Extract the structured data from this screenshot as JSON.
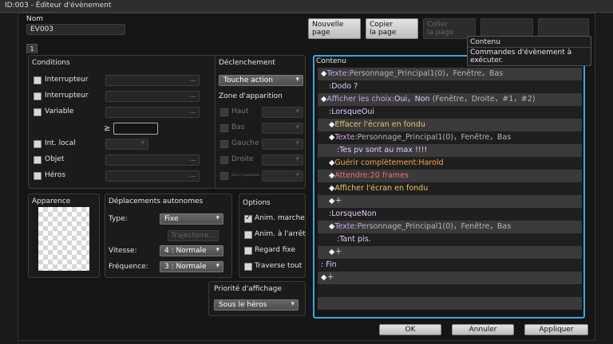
{
  "window_title": "ID:003 - Éditeur d'évènement",
  "name_label": "Nom",
  "name_value": "EV003",
  "page_tab": "1",
  "toolbar": {
    "new_page": [
      "Nouvelle",
      "page"
    ],
    "copy_page": [
      "Copier",
      "la page"
    ],
    "paste_page": [
      "Coller",
      "la page"
    ]
  },
  "tooltip": {
    "title": "Contenu",
    "text": "Commandes d'évènement à exécuter."
  },
  "conditions": {
    "title": "Conditions",
    "switch1": "Interrupteur",
    "switch2": "Interrupteur",
    "variable": "Variable",
    "gte": "≥",
    "self_switch": "Int. local",
    "item": "Objet",
    "actor": "Héros",
    "dots": "..."
  },
  "trigger": {
    "title": "Déclenchement",
    "value": "Touche action",
    "spawn_zone": "Zone d'apparition",
    "up": "Haut",
    "down": "Bas",
    "left": "Gauche",
    "right": "Droite",
    "spawn_zone_small": "Zone d'apparition"
  },
  "appearance": {
    "title": "Apparence"
  },
  "movement": {
    "title": "Déplacements autonomes",
    "type_label": "Type:",
    "type_value": "Fixe",
    "route_button": "Trajectoire...",
    "speed_label": "Vitesse:",
    "speed_value": "4 : Normale",
    "freq_label": "Fréquence:",
    "freq_value": "3 : Normale"
  },
  "options": {
    "title": "Options",
    "walk_anim": "Anim. marche",
    "step_anim": "Anim. à l'arrêt",
    "direction_fix": "Regard fixe",
    "through": "Traverse tout"
  },
  "priority": {
    "title": "Priorité d'affichage",
    "value": "Sous le héros"
  },
  "content": {
    "title": "Contenu",
    "rows": [
      {
        "indent": 0,
        "parts": [
          [
            "◆",
            ""
          ],
          [
            "Texte:",
            "txt"
          ],
          [
            "Personnage_Principal1(0)，Fenêtre，Bas",
            "muted"
          ]
        ]
      },
      {
        "indent": 1,
        "parts": [
          [
            ":Dodo ?",
            "par"
          ]
        ]
      },
      {
        "indent": 0,
        "parts": [
          [
            "◆",
            ""
          ],
          [
            "Afficher les choix:",
            "txt"
          ],
          [
            "Oui，Non ",
            "par"
          ],
          [
            "(Fenêtre，Droite，#1，#2)",
            "muted"
          ]
        ]
      },
      {
        "indent": 1,
        "parts": [
          [
            ":LorsqueOui",
            "par"
          ]
        ]
      },
      {
        "indent": 1,
        "parts": [
          [
            "◆",
            ""
          ],
          [
            "Effacer l'écran en fondu",
            "yel"
          ]
        ]
      },
      {
        "indent": 1,
        "parts": [
          [
            "◆",
            ""
          ],
          [
            "Texte:",
            "txt"
          ],
          [
            "Personnage_Principal1(0)，Fenêtre，Bas",
            "muted"
          ]
        ]
      },
      {
        "indent": 2,
        "parts": [
          [
            ":Tes pv sont au max !!!!",
            "par"
          ]
        ]
      },
      {
        "indent": 1,
        "parts": [
          [
            "◆",
            ""
          ],
          [
            "Guérir complètement:Harold",
            "orng"
          ]
        ]
      },
      {
        "indent": 1,
        "parts": [
          [
            "◆",
            ""
          ],
          [
            "Attendre:20 frames",
            "red"
          ]
        ]
      },
      {
        "indent": 1,
        "parts": [
          [
            "◆",
            ""
          ],
          [
            "Afficher l'écran en fondu",
            "yel"
          ]
        ]
      },
      {
        "indent": 1,
        "parts": [
          [
            "◆＋",
            ""
          ]
        ]
      },
      {
        "indent": 1,
        "parts": [
          [
            ":LorsqueNon",
            "par"
          ]
        ]
      },
      {
        "indent": 1,
        "parts": [
          [
            "◆",
            ""
          ],
          [
            "Texte:",
            "txt"
          ],
          [
            "Personnage_Principal1(0)，Fenêtre，Bas",
            "muted"
          ]
        ]
      },
      {
        "indent": 2,
        "parts": [
          [
            ":Tant pis.",
            "par"
          ]
        ]
      },
      {
        "indent": 1,
        "parts": [
          [
            "◆＋",
            ""
          ]
        ]
      },
      {
        "indent": 0,
        "parts": [
          [
            ": Fin",
            "par"
          ]
        ]
      },
      {
        "indent": 0,
        "parts": [
          [
            "◆＋",
            ""
          ]
        ]
      },
      {
        "indent": 0,
        "parts": [
          [
            "",
            ""
          ]
        ]
      },
      {
        "indent": 0,
        "parts": [
          [
            "",
            ""
          ]
        ]
      }
    ]
  },
  "footer": {
    "ok": "OK",
    "cancel": "Annuler",
    "apply": "Appliquer"
  },
  "colors": {
    "accent": "#3ba6e6"
  }
}
